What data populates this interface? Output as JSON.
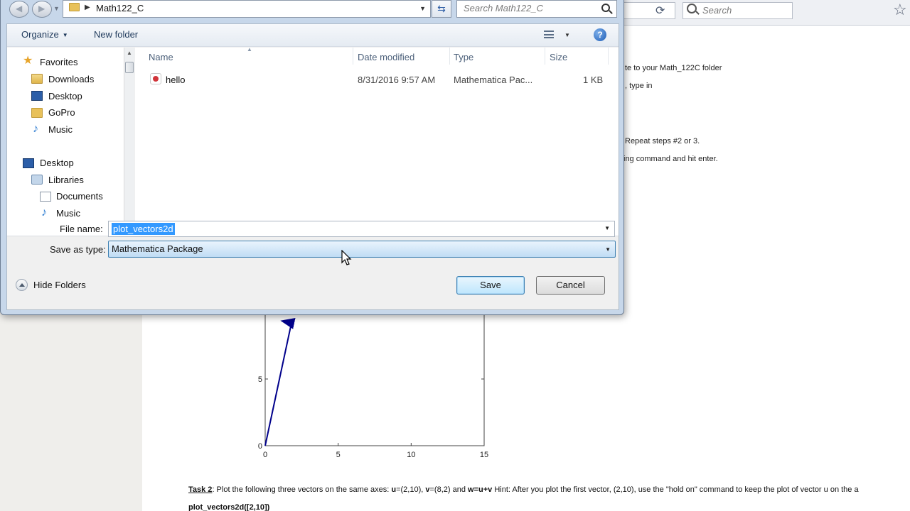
{
  "browser": {
    "search_placeholder": "Search"
  },
  "document": {
    "fragments": [
      "te to your Math_122C folder",
      ", type in",
      "Repeat steps #2 or 3.",
      "ing command and hit enter."
    ],
    "task2": {
      "label": "Task 2",
      "text_1": ": Plot the following three vectors on the same axes: ",
      "u": "u",
      "text_2": "=(2,10), ",
      "v": "v",
      "text_3": "=(8,2) and ",
      "w": "w=u+v",
      "text_4": " Hint: After you plot the first vector, (2,10), use the \"hold on\" command to keep the plot of vector u on the a"
    },
    "code": "plot_vectors2d([2,10])"
  },
  "plot": {
    "y_ticks": [
      "5",
      "0"
    ],
    "x_ticks": [
      "0",
      "5",
      "10",
      "15"
    ]
  },
  "chart_data": {
    "type": "line",
    "title": "",
    "xlabel": "",
    "ylabel": "",
    "xlim": [
      0,
      15
    ],
    "ylim": [
      0,
      10
    ],
    "x_ticks": [
      0,
      5,
      10,
      15
    ],
    "y_ticks": [
      0,
      5
    ],
    "series": [
      {
        "x": [
          0,
          1.8
        ],
        "y": [
          0,
          9.2
        ],
        "color": "#00008b"
      }
    ]
  },
  "dialog": {
    "address": "Math122_C",
    "search_placeholder": "Search Math122_C",
    "toolbar": {
      "organize": "Organize",
      "new_folder": "New folder"
    },
    "nav": {
      "favorites": "Favorites",
      "items": [
        "Downloads",
        "Desktop",
        "GoPro",
        "Music"
      ],
      "desktop": "Desktop",
      "libraries": "Libraries",
      "lib_items": [
        "Documents",
        "Music"
      ]
    },
    "columns": {
      "name": "Name",
      "date": "Date modified",
      "type": "Type",
      "size": "Size"
    },
    "files": [
      {
        "name": "hello",
        "date": "8/31/2016 9:57 AM",
        "type": "Mathematica Pac...",
        "size": "1 KB"
      }
    ],
    "file_name_label": "File name:",
    "file_name_value": "plot_vectors2d",
    "save_type_label": "Save as type:",
    "save_type_value": "Mathematica Package",
    "hide_folders": "Hide Folders",
    "save": "Save",
    "cancel": "Cancel"
  }
}
